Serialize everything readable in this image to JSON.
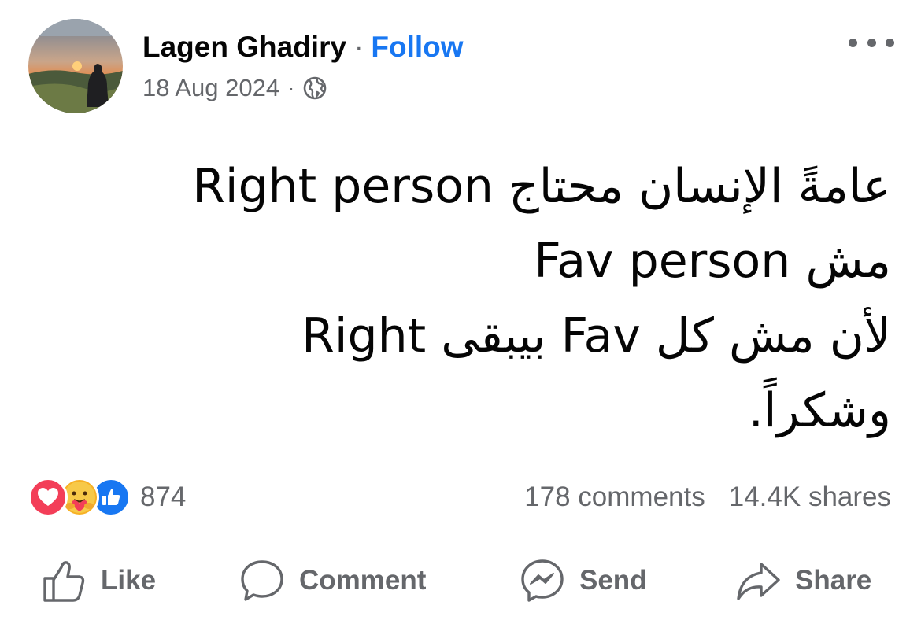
{
  "author": {
    "name": "Lagen Ghadiry",
    "separator": "·",
    "follow_label": "Follow"
  },
  "meta": {
    "date": "18 Aug 2024",
    "separator": "·",
    "audience_icon": "globe-icon"
  },
  "post": {
    "lines": [
      "عامةً الإنسان محتاج Right person",
      "مش Fav person",
      "لأن مش كل Fav بيبقى Right",
      "وشكراً."
    ]
  },
  "reactions": {
    "icons": [
      "love-icon",
      "care-icon",
      "like-icon"
    ],
    "count": "874"
  },
  "stats": {
    "comments": "178 comments",
    "shares": "14.4K shares"
  },
  "actions": {
    "like_label": "Like",
    "comment_label": "Comment",
    "send_label": "Send",
    "share_label": "Share"
  },
  "colors": {
    "follow": "#1877f2",
    "secondary_text": "#65676b",
    "love": "#f33e58",
    "care": "#f7b125",
    "like": "#1877f2"
  }
}
